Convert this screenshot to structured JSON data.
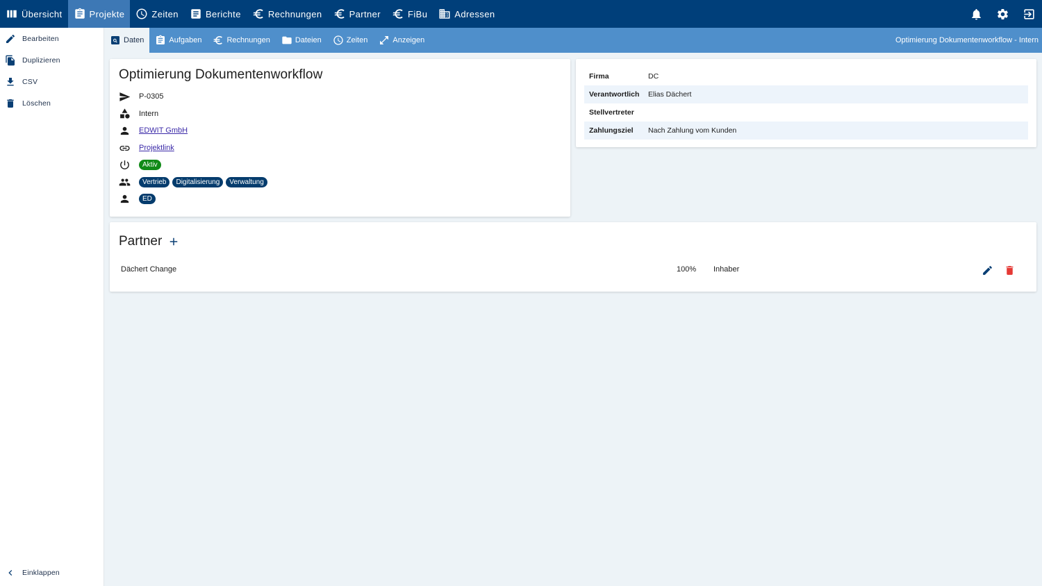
{
  "topnav": {
    "items": [
      {
        "label": "Übersicht",
        "icon": "columns-icon"
      },
      {
        "label": "Projekte",
        "icon": "clipboard-icon",
        "active": true
      },
      {
        "label": "Zeiten",
        "icon": "clock-icon"
      },
      {
        "label": "Berichte",
        "icon": "report-icon"
      },
      {
        "label": "Rechnungen",
        "icon": "euro-icon"
      },
      {
        "label": "Partner",
        "icon": "euro-icon"
      },
      {
        "label": "FiBu",
        "icon": "euro-icon"
      },
      {
        "label": "Adressen",
        "icon": "building-icon"
      }
    ],
    "right_icons": [
      "bell-icon",
      "gear-icon",
      "logout-icon"
    ]
  },
  "sidebar": {
    "items": [
      {
        "label": "Bearbeiten",
        "icon": "pencil-icon"
      },
      {
        "label": "Duplizieren",
        "icon": "copy-icon"
      },
      {
        "label": "CSV",
        "icon": "download-icon"
      },
      {
        "label": "Löschen",
        "icon": "trash-icon"
      }
    ],
    "collapse_label": "Einklappen"
  },
  "subnav": {
    "items": [
      {
        "label": "Daten",
        "icon": "search-doc-icon",
        "active": true
      },
      {
        "label": "Aufgaben",
        "icon": "clipboard-icon"
      },
      {
        "label": "Rechnungen",
        "icon": "euro-icon"
      },
      {
        "label": "Dateien",
        "icon": "folder-icon"
      },
      {
        "label": "Zeiten",
        "icon": "clock-icon"
      },
      {
        "label": "Anzeigen",
        "icon": "expand-icon"
      }
    ],
    "title": "Optimierung Dokumentenworkflow - Intern"
  },
  "project": {
    "title": "Optimierung Dokumentenworkflow",
    "number": "P-0305",
    "category": "Intern",
    "customer": "EDWIT GmbH",
    "link": "Projektlink",
    "status": "Aktiv",
    "departments": [
      "Vertrieb",
      "Digitalisierung",
      "Verwaltung"
    ],
    "member": "ED"
  },
  "details": {
    "rows": [
      {
        "key": "Firma",
        "value": "DC"
      },
      {
        "key": "Verantwortlich",
        "value": "Elias Dächert"
      },
      {
        "key": "Stellvertreter",
        "value": ""
      },
      {
        "key": "Zahlungsziel",
        "value": "Nach Zahlung vom Kunden"
      }
    ]
  },
  "partner": {
    "title": "Partner",
    "rows": [
      {
        "name": "Dächert Change",
        "percent": "100%",
        "role": "Inhaber"
      }
    ]
  },
  "colors": {
    "topnav_bg": "#003f7a",
    "topnav_active": "#3d78b5",
    "subnav_bg": "#4f8fcb",
    "status_green": "#108a17",
    "badge_navy": "#053c6d",
    "delete_red": "#e53935"
  }
}
